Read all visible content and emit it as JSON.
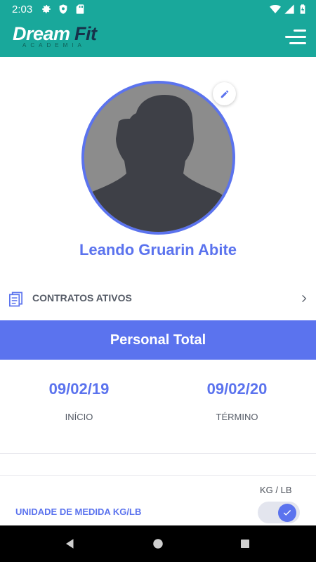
{
  "status_bar": {
    "time": "2:03",
    "icons": [
      "gear-icon",
      "shield-icon",
      "sd-card-icon",
      "wifi-icon",
      "signal-icon",
      "battery-icon"
    ]
  },
  "header": {
    "logo": {
      "text_primary": "Dream",
      "text_secondary": "Fit",
      "subtitle": "ACADEMIA"
    },
    "menu_icon": "menu-icon"
  },
  "colors": {
    "header_bg": "#19a89b",
    "accent": "#5b73ee",
    "text_muted": "#555b66",
    "nav_bg": "#000000"
  },
  "profile": {
    "name": "Leando Gruarin Abite",
    "edit_icon": "pencil-icon"
  },
  "contracts": {
    "label": "CONTRATOS ATIVOS"
  },
  "plan": {
    "name": "Personal Total",
    "start_date": "09/02/19",
    "start_label": "INÍCIO",
    "end_date": "09/02/20",
    "end_label": "TÉRMINO"
  },
  "settings": {
    "unit_header": "KG / LB",
    "unit_label": "UNIDADE DE MEDIDA KG/LB",
    "unit_toggle_on": true
  },
  "nav_bar": {
    "icons": [
      "back-icon",
      "home-icon",
      "recents-icon"
    ]
  }
}
